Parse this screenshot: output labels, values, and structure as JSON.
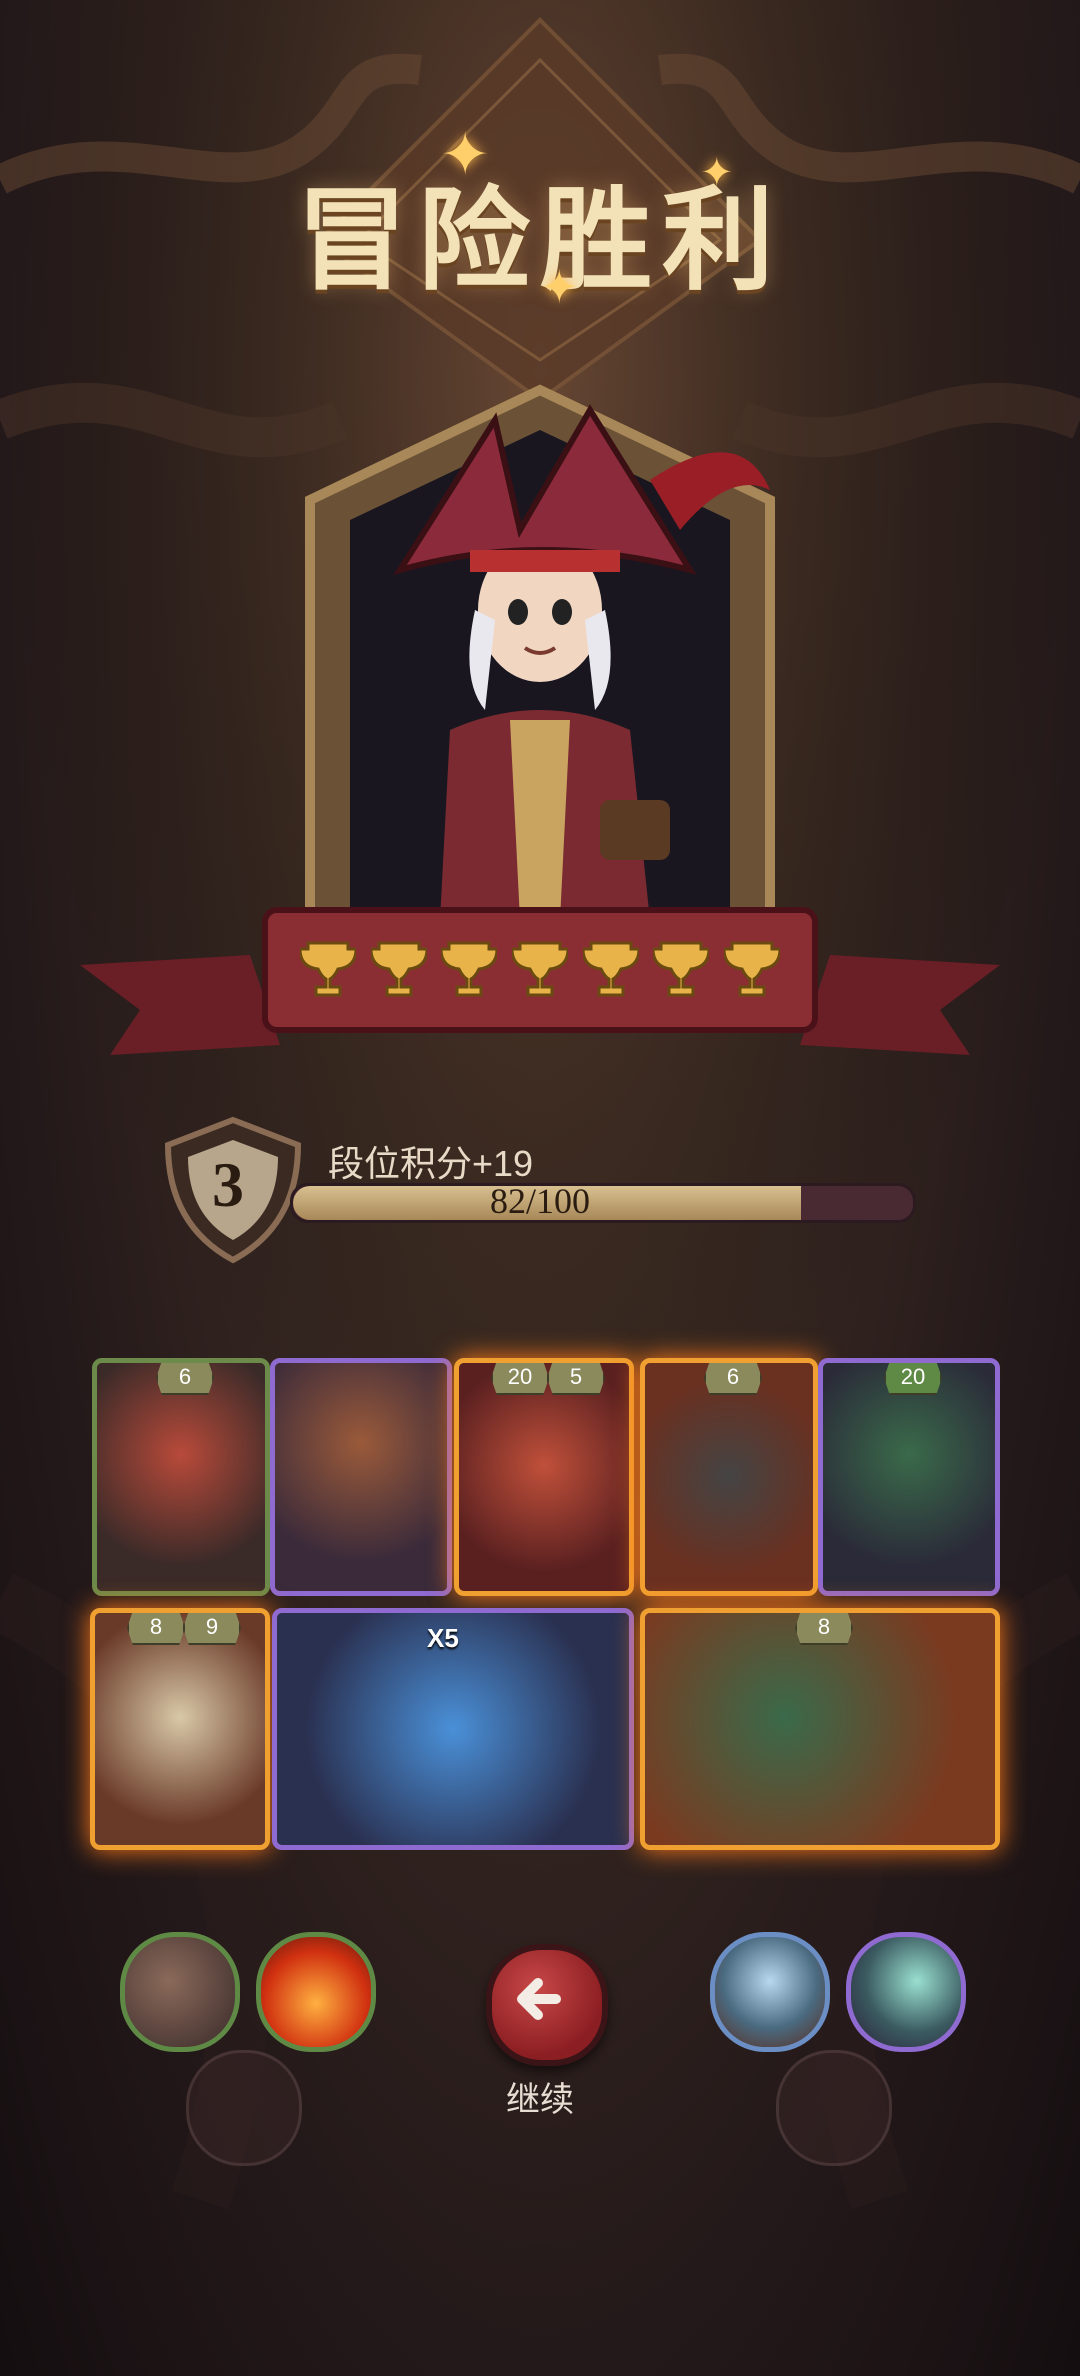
{
  "title": "冒险胜利",
  "hero": {
    "icon": "pirate-hero-portrait",
    "trophy_count": 7
  },
  "rank": {
    "level": "3",
    "label": "段位积分+19",
    "progress_text": "82/100",
    "progress_fraction": 0.82
  },
  "cards": [
    {
      "name": "snake-witch-card",
      "badges": [
        "6"
      ],
      "rarity": "green"
    },
    {
      "name": "owl-card",
      "badges": [],
      "rarity": "purple"
    },
    {
      "name": "crab-card",
      "badges": [
        "20",
        "5"
      ],
      "rarity": "fire"
    },
    {
      "name": "spider-card",
      "badges": [
        "6"
      ],
      "rarity": "fire"
    },
    {
      "name": "cat-mage-card",
      "badges": [
        "20"
      ],
      "rarity": "purple"
    },
    {
      "name": "pelican-card",
      "badges": [
        "8",
        "9"
      ],
      "rarity": "fire"
    },
    {
      "name": "clock-beast-card",
      "badges": [],
      "rarity": "purple",
      "multiplier": "X5"
    },
    {
      "name": "parrot-card",
      "badges": [
        "8"
      ],
      "rarity": "fire"
    }
  ],
  "skills_left": [
    "rock-skill-icon",
    "flame-skill-icon"
  ],
  "skills_right": [
    "crystal-skill-icon",
    "dragon-scale-skill-icon"
  ],
  "continue_label": "继续",
  "colors": {
    "gold": "#f3e2b8",
    "fire": "#ff7a1a",
    "purple": "#8f6ad0",
    "green": "#6c8a4a"
  }
}
